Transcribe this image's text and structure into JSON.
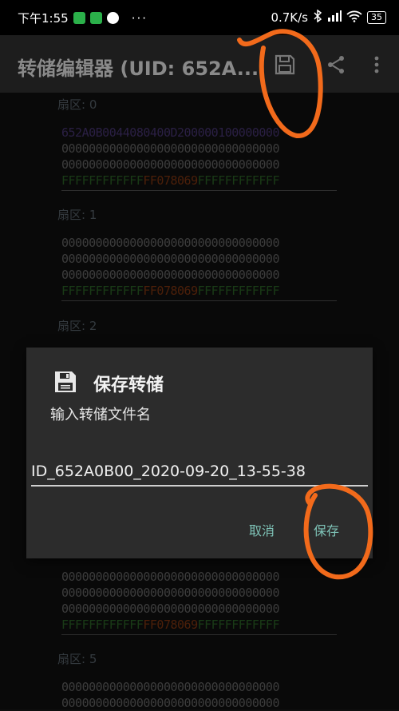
{
  "status": {
    "time": "下午1:55",
    "net_speed": "0.7K/s",
    "battery": "35"
  },
  "toolbar": {
    "title": "转储编辑器 (UID: 652A..."
  },
  "sectors": [
    {
      "label": "扇区: 0",
      "blocks": [
        "652A0B0044080400D200000100000000",
        "00000000000000000000000000000000",
        "00000000000000000000000000000000"
      ],
      "trailer": {
        "keyA": "FFFFFFFFFFFF",
        "access": "FF078069",
        "keyB": "FFFFFFFFFFFF"
      }
    },
    {
      "label": "扇区: 1",
      "blocks": [
        "00000000000000000000000000000000",
        "00000000000000000000000000000000",
        "00000000000000000000000000000000"
      ],
      "trailer": {
        "keyA": "FFFFFFFFFFFF",
        "access": "FF078069",
        "keyB": "FFFFFFFFFFFF"
      }
    },
    {
      "label": "扇区: 2"
    },
    {
      "blocks": [
        "00000000000000000000000000000000",
        "00000000000000000000000000000000",
        "00000000000000000000000000000000"
      ],
      "trailer": {
        "keyA": "FFFFFFFFFFFF",
        "access": "FF078069",
        "keyB": "FFFFFFFFFFFF"
      }
    },
    {
      "label": "扇区: 5",
      "blocks": [
        "00000000000000000000000000000000",
        "00000000000000000000000000000000"
      ]
    }
  ],
  "dialog": {
    "title": "保存转储",
    "message": "输入转储文件名",
    "filename": "ID_652A0B00_2020-09-20_13-55-38",
    "cancel_label": "取消",
    "save_label": "保存"
  },
  "colors": {
    "accent": "#7fc4b8",
    "annotation": "#f26a1b"
  }
}
